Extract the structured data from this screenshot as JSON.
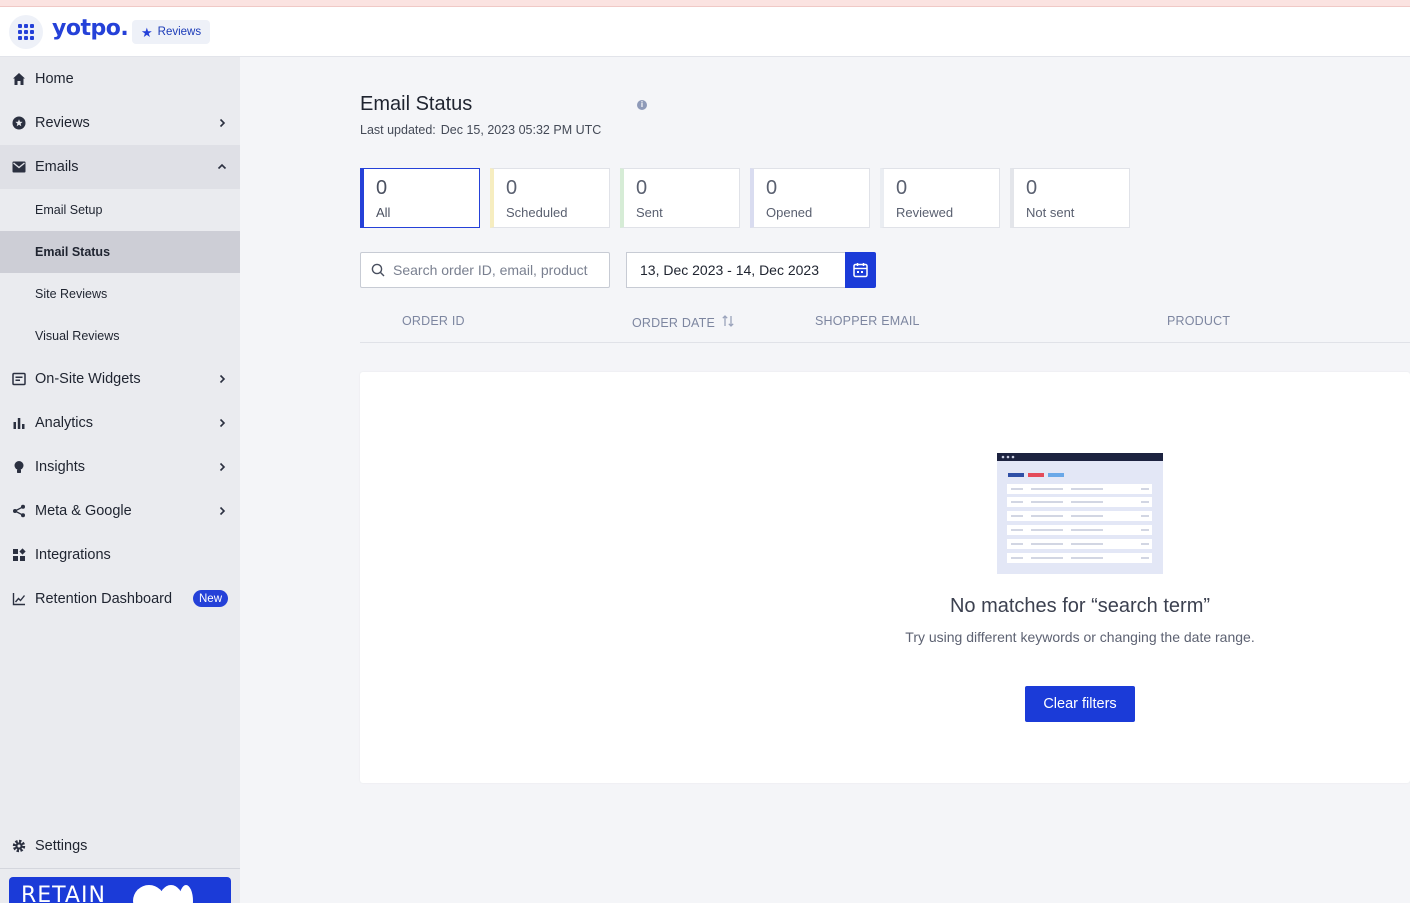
{
  "header": {
    "logo": "yotpo.",
    "product_badge": "Reviews"
  },
  "sidebar": {
    "items": [
      {
        "label": "Home",
        "icon": "home-icon"
      },
      {
        "label": "Reviews",
        "icon": "star-circle-icon"
      },
      {
        "label": "Emails",
        "icon": "mail-icon",
        "expanded": true
      },
      {
        "label": "On-Site Widgets",
        "icon": "widget-icon"
      },
      {
        "label": "Analytics",
        "icon": "bar-chart-icon"
      },
      {
        "label": "Insights",
        "icon": "lightbulb-icon"
      },
      {
        "label": "Meta & Google",
        "icon": "share-icon"
      },
      {
        "label": "Integrations",
        "icon": "integrations-icon"
      },
      {
        "label": "Retention Dashboard",
        "icon": "line-chart-icon",
        "badge": "New"
      }
    ],
    "sub_items": [
      {
        "label": "Email Setup"
      },
      {
        "label": "Email Status",
        "selected": true
      },
      {
        "label": "Site Reviews"
      },
      {
        "label": "Visual Reviews"
      }
    ],
    "settings": {
      "label": "Settings",
      "icon": "gear-icon"
    },
    "banner_text": "RETAIN"
  },
  "page": {
    "title": "Email Status",
    "last_updated_label": "Last updated:",
    "last_updated_value": "Dec 15, 2023 05:32 PM UTC"
  },
  "stats": [
    {
      "value": "0",
      "label": "All",
      "color": "#2541d8"
    },
    {
      "value": "0",
      "label": "Scheduled",
      "color": "#f6edc0"
    },
    {
      "value": "0",
      "label": "Sent",
      "color": "#d6ecd6"
    },
    {
      "value": "0",
      "label": "Opened",
      "color": "#d9dcf0"
    },
    {
      "value": "0",
      "label": "Reviewed",
      "color": "#eaedf2"
    },
    {
      "value": "0",
      "label": "Not sent",
      "color": "#e3e5ea"
    }
  ],
  "filters": {
    "search_placeholder": "Search order ID, email, product",
    "date_range": "13, Dec 2023 - 14, Dec 2023"
  },
  "table": {
    "columns": [
      "ORDER ID",
      "ORDER DATE",
      "SHOPPER EMAIL",
      "PRODUCT"
    ]
  },
  "empty_state": {
    "title": "No matches for “search term”",
    "subtitle": "Try using different keywords or changing the date range.",
    "button": "Clear filters"
  },
  "colors": {
    "accent": "#1b3bd8",
    "sidebar_bg": "#eaebef",
    "selected_bg": "#cdced6"
  }
}
